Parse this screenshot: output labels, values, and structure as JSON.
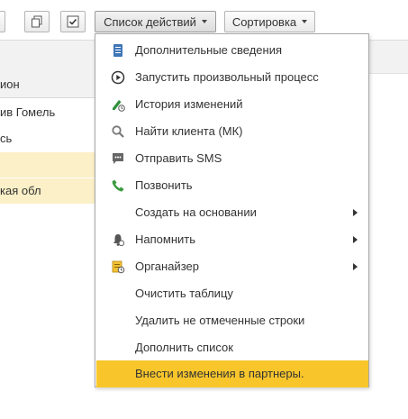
{
  "toolbar": {
    "actions_label": "Список действий",
    "sort_label": "Сортировка"
  },
  "table": {
    "column_header": "ион",
    "rows": [
      "ив Гомель",
      "сь",
      "",
      "кая обл"
    ]
  },
  "menu": {
    "items": [
      {
        "label": "Дополнительные сведения",
        "icon": "document-icon"
      },
      {
        "label": "Запустить произвольный процесс",
        "icon": "play-circle-icon"
      },
      {
        "label": "История изменений",
        "icon": "history-pencil-icon"
      },
      {
        "label": "Найти клиента (МК)",
        "icon": "search-icon"
      },
      {
        "label": "Отправить SMS",
        "icon": "chat-bubble-icon"
      },
      {
        "label": "Позвонить",
        "icon": "phone-icon"
      },
      {
        "label": "Создать на основании",
        "icon": "",
        "submenu": true
      },
      {
        "label": "Напомнить",
        "icon": "bell-icon",
        "submenu": true
      },
      {
        "label": "Органайзер",
        "icon": "organizer-icon",
        "submenu": true
      },
      {
        "label": "Очистить таблицу",
        "icon": ""
      },
      {
        "label": "Удалить не отмеченные строки",
        "icon": ""
      },
      {
        "label": "Дополнить список",
        "icon": ""
      },
      {
        "label": "Внести изменения в партнеры.",
        "icon": "",
        "active": true
      }
    ]
  },
  "colors": {
    "highlight": "#f8c62b",
    "row_highlight": "#fbf0c7",
    "menu_border": "#a8a8a8"
  }
}
